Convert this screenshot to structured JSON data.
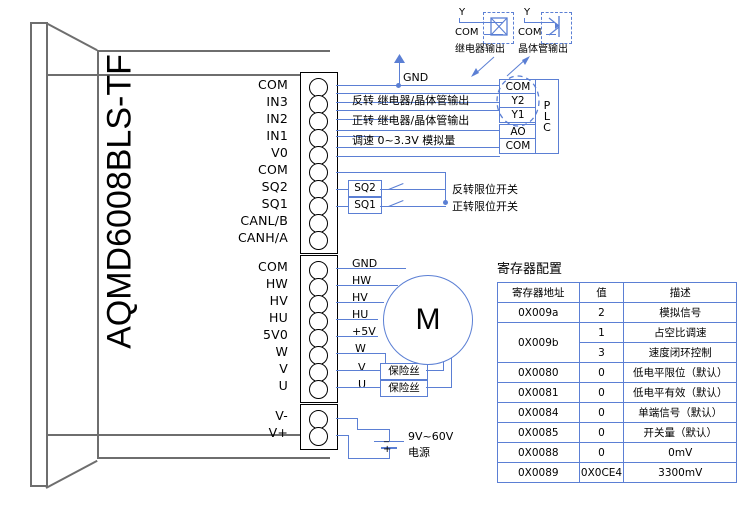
{
  "product": {
    "name": "AQMD6008BLS-TF"
  },
  "terminals": {
    "group1": [
      "COM",
      "IN3",
      "IN2",
      "IN1",
      "V0",
      "COM",
      "SQ2",
      "SQ1",
      "CANL/B",
      "CANH/A"
    ],
    "group2": [
      "COM",
      "HW",
      "HV",
      "HU",
      "5V0",
      "W",
      "V",
      "U"
    ],
    "group3": [
      "V-",
      "V+"
    ]
  },
  "wire_labels": {
    "gnd": "GND",
    "in3": "反转 继电器/晶体管输出",
    "in2": "正转 继电器/晶体管输出",
    "in1": "调速    0~3.3V 模拟量",
    "sq2_box": "SQ2",
    "sq1_box": "SQ1",
    "sq2_desc": "反转限位开关",
    "sq1_desc": "正转限位开关",
    "m_gnd": "GND",
    "m_hw": "HW",
    "m_hv": "HV",
    "m_hu": "HU",
    "m_5v": "+5V",
    "m_w": "W",
    "m_v": "V",
    "m_u": "U",
    "fuse1": "保险丝",
    "fuse2": "保险丝",
    "motor": "M",
    "power_range": "9V~60V",
    "power_label": "电源",
    "power_plus": "+",
    "power_minus": "_"
  },
  "plc": {
    "name": "PLC",
    "letters": [
      "P",
      "L",
      "C"
    ],
    "terminals": [
      "COM",
      "Y2",
      "Y1",
      "AO",
      "COM"
    ]
  },
  "output_symbols": {
    "relay": {
      "y": "Y",
      "com": "COM",
      "caption": "继电器输出"
    },
    "transistor": {
      "y": "Y",
      "com": "COM",
      "caption": "晶体管输出"
    }
  },
  "register_table": {
    "title": "寄存器配置",
    "headers": [
      "寄存器地址",
      "值",
      "描述"
    ],
    "rows": [
      {
        "address": "0X009a",
        "value": "2",
        "desc": "模拟信号",
        "rowspan": 1
      },
      {
        "address": "0X009b",
        "value": "1",
        "desc": "占空比调速",
        "rowspan": 2
      },
      {
        "address": "",
        "value": "3",
        "desc": "速度闭环控制",
        "rowspan": 0
      },
      {
        "address": "0X0080",
        "value": "0",
        "desc": "低电平限位（默认）",
        "rowspan": 1
      },
      {
        "address": "0X0081",
        "value": "0",
        "desc": "低电平有效（默认）",
        "rowspan": 1
      },
      {
        "address": "0X0084",
        "value": "0",
        "desc": "单端信号（默认）",
        "rowspan": 1
      },
      {
        "address": "0X0085",
        "value": "0",
        "desc": "开关量（默认）",
        "rowspan": 1
      },
      {
        "address": "0X0088",
        "value": "0",
        "desc": "0mV",
        "rowspan": 1
      },
      {
        "address": "0X0089",
        "value": "0X0CE4",
        "desc": "3300mV",
        "rowspan": 1
      }
    ]
  },
  "colors": {
    "wire": "#5b7fd4",
    "body": "#6e6e6e",
    "outline": "#000000"
  }
}
